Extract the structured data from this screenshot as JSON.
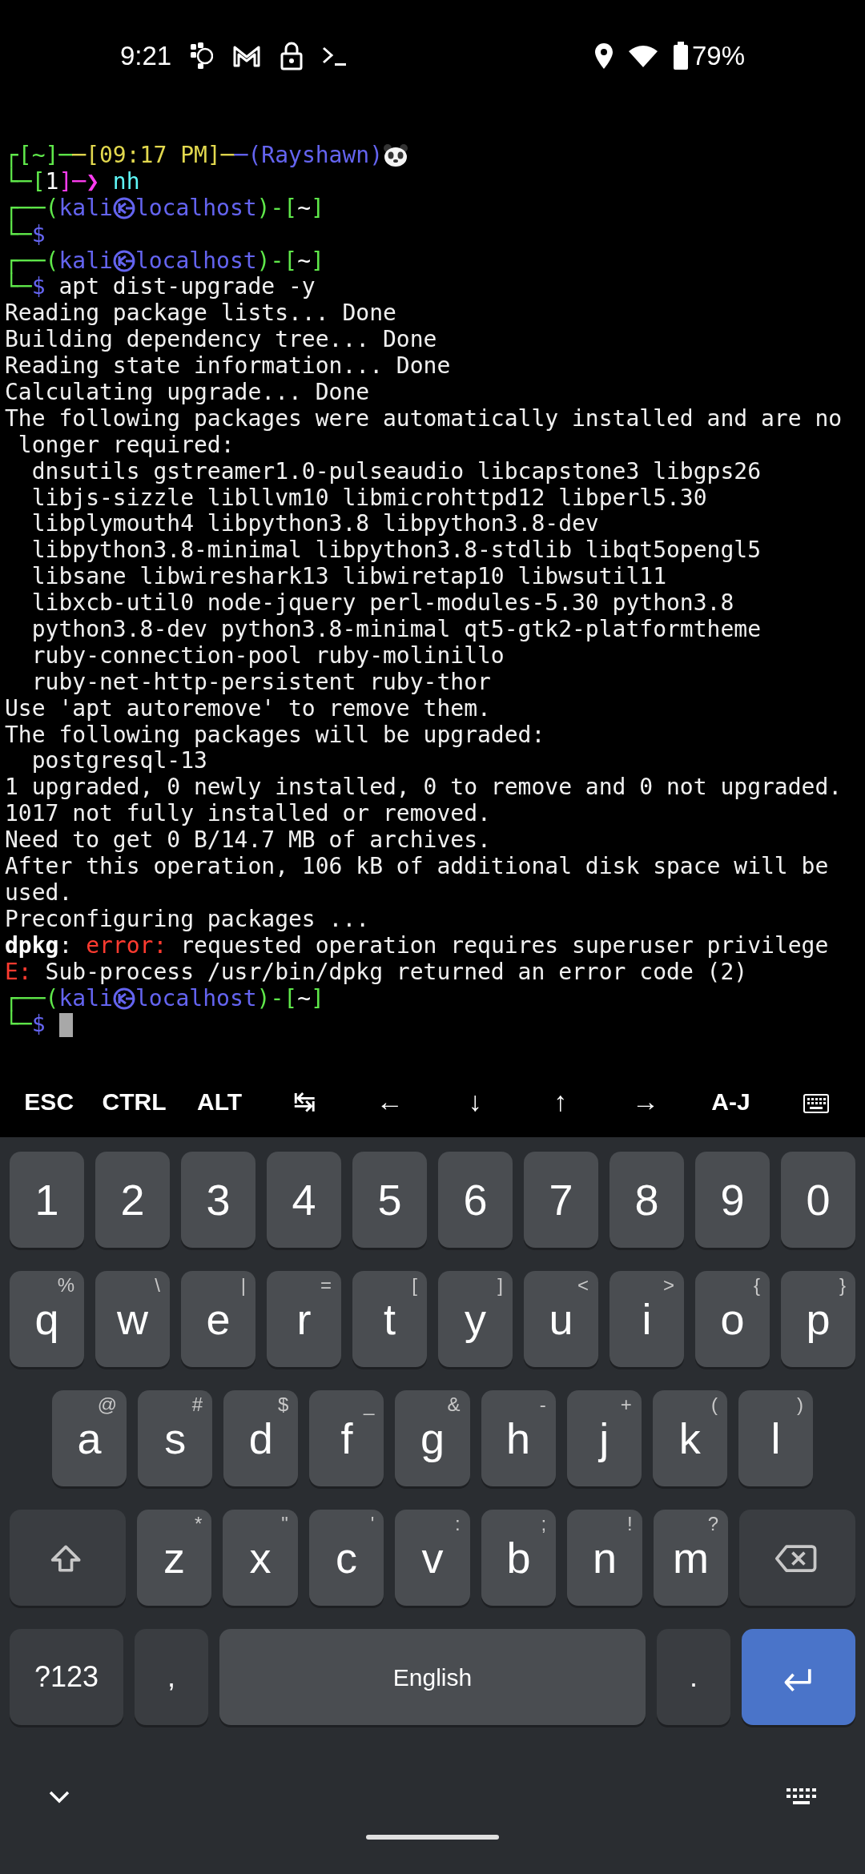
{
  "status_bar": {
    "time": "9:21",
    "battery": "79%"
  },
  "terminal": {
    "lines": [
      [
        {
          "text": "┌[~]─",
          "color": "#5fe84a"
        },
        {
          "text": "─[09:17 PM]─",
          "color": "#e2d84e"
        },
        {
          "text": "─(Rayshawn)",
          "color": "#6464f0"
        },
        {
          "kind": "emoji"
        }
      ],
      [
        {
          "text": "└─[",
          "color": "#5fe84a"
        },
        {
          "text": "1",
          "color": "#ffffff"
        },
        {
          "text": "]─❯",
          "color": "#ff3cf0"
        },
        {
          "text": " nh",
          "color": "#5ff8f8"
        }
      ],
      [
        {
          "text": "┌──(",
          "color": "#5fe84a"
        },
        {
          "text": "kali",
          "color": "#6464f0"
        },
        {
          "kind": "symbol",
          "color": "#6464f0"
        },
        {
          "text": "localhost",
          "color": "#6464f0"
        },
        {
          "text": ")-[",
          "color": "#5fe84a"
        },
        {
          "text": "~",
          "color": "#ffffff"
        },
        {
          "text": "]",
          "color": "#5fe84a"
        }
      ],
      [
        {
          "text": "└─",
          "color": "#5fe84a"
        },
        {
          "text": "$",
          "color": "#6464f0"
        }
      ],
      [
        {
          "text": "┌──(",
          "color": "#5fe84a"
        },
        {
          "text": "kali",
          "color": "#6464f0"
        },
        {
          "kind": "symbol",
          "color": "#6464f0"
        },
        {
          "text": "localhost",
          "color": "#6464f0"
        },
        {
          "text": ")-[",
          "color": "#5fe84a"
        },
        {
          "text": "~",
          "color": "#ffffff"
        },
        {
          "text": "]",
          "color": "#5fe84a"
        }
      ],
      [
        {
          "text": "└─",
          "color": "#5fe84a"
        },
        {
          "text": "$",
          "color": "#6464f0"
        },
        {
          "text": " apt dist-upgrade -y",
          "color": "#f0f0f0"
        }
      ],
      [
        {
          "text": "Reading package lists... Done",
          "color": "#f0f0f0"
        }
      ],
      [
        {
          "text": "Building dependency tree... Done",
          "color": "#f0f0f0"
        }
      ],
      [
        {
          "text": "Reading state information... Done",
          "color": "#f0f0f0"
        }
      ],
      [
        {
          "text": "Calculating upgrade... Done",
          "color": "#f0f0f0"
        }
      ],
      [
        {
          "text": "The following packages were automatically installed and are no",
          "color": "#f0f0f0"
        }
      ],
      [
        {
          "text": " longer required:",
          "color": "#f0f0f0"
        }
      ],
      [
        {
          "text": "  dnsutils gstreamer1.0-pulseaudio libcapstone3 libgps26",
          "color": "#f0f0f0"
        }
      ],
      [
        {
          "text": "  libjs-sizzle libllvm10 libmicrohttpd12 libperl5.30",
          "color": "#f0f0f0"
        }
      ],
      [
        {
          "text": "  libplymouth4 libpython3.8 libpython3.8-dev",
          "color": "#f0f0f0"
        }
      ],
      [
        {
          "text": "  libpython3.8-minimal libpython3.8-stdlib libqt5opengl5",
          "color": "#f0f0f0"
        }
      ],
      [
        {
          "text": "  libsane libwireshark13 libwiretap10 libwsutil11",
          "color": "#f0f0f0"
        }
      ],
      [
        {
          "text": "  libxcb-util0 node-jquery perl-modules-5.30 python3.8",
          "color": "#f0f0f0"
        }
      ],
      [
        {
          "text": "  python3.8-dev python3.8-minimal qt5-gtk2-platformtheme",
          "color": "#f0f0f0"
        }
      ],
      [
        {
          "text": "  ruby-connection-pool ruby-molinillo",
          "color": "#f0f0f0"
        }
      ],
      [
        {
          "text": "  ruby-net-http-persistent ruby-thor",
          "color": "#f0f0f0"
        }
      ],
      [
        {
          "text": "Use 'apt autoremove' to remove them.",
          "color": "#f0f0f0"
        }
      ],
      [
        {
          "text": "The following packages will be upgraded:",
          "color": "#f0f0f0"
        }
      ],
      [
        {
          "text": "  postgresql-13",
          "color": "#f0f0f0"
        }
      ],
      [
        {
          "text": "1 upgraded, 0 newly installed, 0 to remove and 0 not upgraded.",
          "color": "#f0f0f0"
        }
      ],
      [
        {
          "text": "1017 not fully installed or removed.",
          "color": "#f0f0f0"
        }
      ],
      [
        {
          "text": "Need to get 0 B/14.7 MB of archives.",
          "color": "#f0f0f0"
        }
      ],
      [
        {
          "text": "After this operation, 106 kB of additional disk space will be",
          "color": "#f0f0f0"
        }
      ],
      [
        {
          "text": "used.",
          "color": "#f0f0f0"
        }
      ],
      [
        {
          "text": "Preconfiguring packages ...",
          "color": "#f0f0f0"
        }
      ],
      [
        {
          "text": "dpkg",
          "color": "#ffffff",
          "bold": true
        },
        {
          "text": ": ",
          "color": "#f0f0f0"
        },
        {
          "text": "error:",
          "color": "#ff3b30"
        },
        {
          "text": " requested operation requires superuser privilege",
          "color": "#f0f0f0"
        }
      ],
      [
        {
          "text": "E:",
          "color": "#ff3b30"
        },
        {
          "text": " Sub-process /usr/bin/dpkg returned an error code (2)",
          "color": "#f0f0f0"
        }
      ],
      [
        {
          "text": "┌──(",
          "color": "#5fe84a"
        },
        {
          "text": "kali",
          "color": "#6464f0"
        },
        {
          "kind": "symbol",
          "color": "#6464f0"
        },
        {
          "text": "localhost",
          "color": "#6464f0"
        },
        {
          "text": ")-[",
          "color": "#5fe84a"
        },
        {
          "text": "~",
          "color": "#ffffff"
        },
        {
          "text": "]",
          "color": "#5fe84a"
        }
      ],
      [
        {
          "text": "└─",
          "color": "#5fe84a"
        },
        {
          "text": "$",
          "color": "#6464f0"
        },
        {
          "kind": "cursor"
        }
      ]
    ]
  },
  "extra_keys": [
    {
      "label": "ESC",
      "kind": "text"
    },
    {
      "label": "CTRL",
      "kind": "text"
    },
    {
      "label": "ALT",
      "kind": "text"
    },
    {
      "label": "↹",
      "kind": "arrow"
    },
    {
      "label": "←",
      "kind": "arrow"
    },
    {
      "label": "↓",
      "kind": "arrow"
    },
    {
      "label": "↑",
      "kind": "arrow"
    },
    {
      "label": "→",
      "kind": "arrow"
    },
    {
      "label": "A-J",
      "kind": "text"
    },
    {
      "kind": "keyboard"
    }
  ],
  "keyboard": {
    "rows": [
      {
        "keys": [
          {
            "label": "1"
          },
          {
            "label": "2"
          },
          {
            "label": "3"
          },
          {
            "label": "4"
          },
          {
            "label": "5"
          },
          {
            "label": "6"
          },
          {
            "label": "7"
          },
          {
            "label": "8"
          },
          {
            "label": "9"
          },
          {
            "label": "0"
          }
        ]
      },
      {
        "keys": [
          {
            "label": "q",
            "hint": "%"
          },
          {
            "label": "w",
            "hint": "\\"
          },
          {
            "label": "e",
            "hint": "|"
          },
          {
            "label": "r",
            "hint": "="
          },
          {
            "label": "t",
            "hint": "["
          },
          {
            "label": "y",
            "hint": "]"
          },
          {
            "label": "u",
            "hint": "<"
          },
          {
            "label": "i",
            "hint": ">"
          },
          {
            "label": "o",
            "hint": "{"
          },
          {
            "label": "p",
            "hint": "}"
          }
        ]
      },
      {
        "keys": [
          {
            "label": "a",
            "hint": "@"
          },
          {
            "label": "s",
            "hint": "#"
          },
          {
            "label": "d",
            "hint": "$"
          },
          {
            "label": "f",
            "hint": "_"
          },
          {
            "label": "g",
            "hint": "&"
          },
          {
            "label": "h",
            "hint": "-"
          },
          {
            "label": "j",
            "hint": "+"
          },
          {
            "label": "k",
            "hint": "("
          },
          {
            "label": "l",
            "hint": ")"
          }
        ]
      },
      {
        "keys": [
          {
            "kind": "shift"
          },
          {
            "label": "z",
            "hint": "*"
          },
          {
            "label": "x",
            "hint": "\""
          },
          {
            "label": "c",
            "hint": "'"
          },
          {
            "label": "v",
            "hint": ":"
          },
          {
            "label": "b",
            "hint": ";"
          },
          {
            "label": "n",
            "hint": "!"
          },
          {
            "label": "m",
            "hint": "?"
          },
          {
            "kind": "backspace"
          }
        ]
      },
      {
        "keys": [
          {
            "label": "?123",
            "kind": "symbols"
          },
          {
            "label": ",",
            "kind": "punct"
          },
          {
            "label": "English",
            "kind": "space"
          },
          {
            "label": ".",
            "kind": "punct"
          },
          {
            "kind": "enter"
          }
        ]
      }
    ]
  }
}
